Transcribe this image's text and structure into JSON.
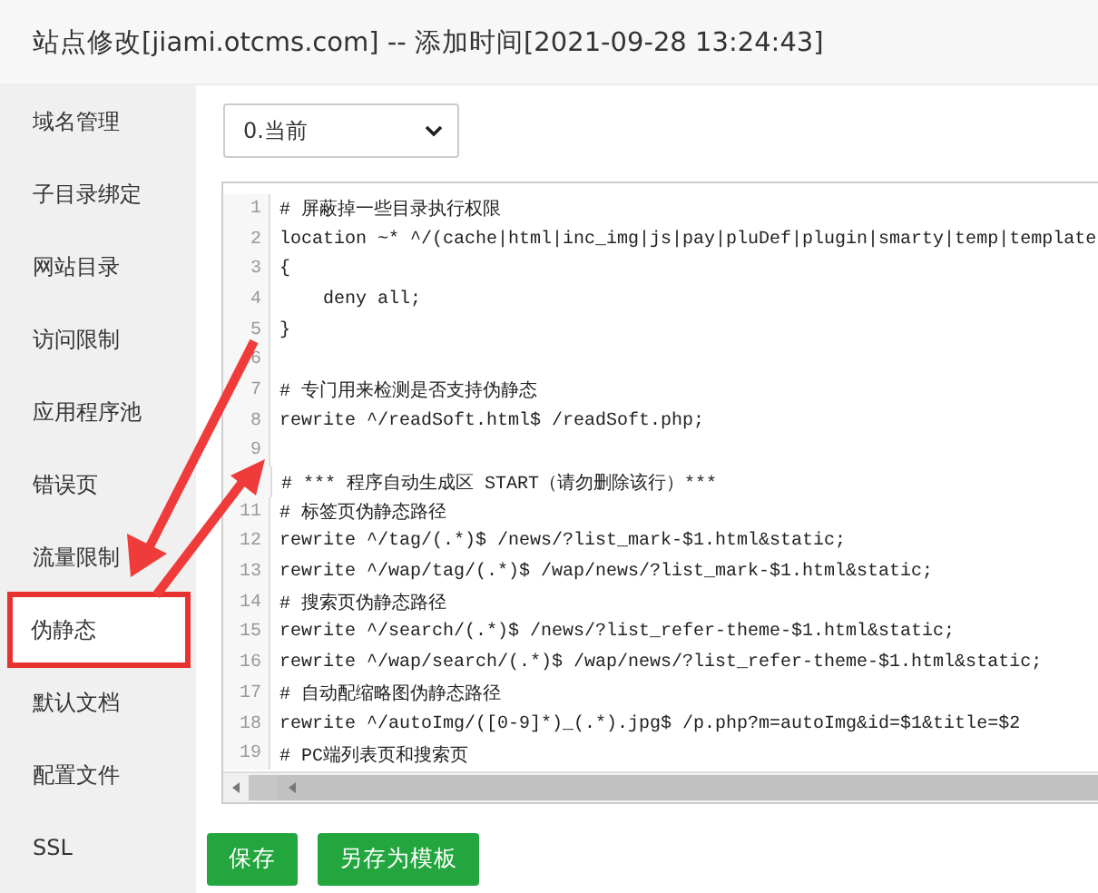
{
  "window": {
    "title": "站点修改[jiami.otcms.com] -- 添加时间[2021-09-28 13:24:43]"
  },
  "sidebar": {
    "items": [
      {
        "label": "域名管理",
        "selected": false,
        "highlighted": false
      },
      {
        "label": "子目录绑定",
        "selected": false,
        "highlighted": false
      },
      {
        "label": "网站目录",
        "selected": false,
        "highlighted": false
      },
      {
        "label": "访问限制",
        "selected": false,
        "highlighted": false
      },
      {
        "label": "应用程序池",
        "selected": false,
        "highlighted": false
      },
      {
        "label": "错误页",
        "selected": false,
        "highlighted": false
      },
      {
        "label": "流量限制",
        "selected": false,
        "highlighted": false
      },
      {
        "label": "伪静态",
        "selected": true,
        "highlighted": true
      },
      {
        "label": "默认文档",
        "selected": false,
        "highlighted": false
      },
      {
        "label": "配置文件",
        "selected": false,
        "highlighted": false
      },
      {
        "label": "SSL",
        "selected": false,
        "highlighted": false
      }
    ]
  },
  "version_select": {
    "value": "0.当前"
  },
  "editor": {
    "lines": [
      {
        "number": "1",
        "text": "# 屏蔽掉一些目录执行权限"
      },
      {
        "number": "2",
        "text": "location ~* ^/(cache|html|inc_img|js|pay|pluDef|plugin|smarty|temp|template"
      },
      {
        "number": "3",
        "text": "{"
      },
      {
        "number": "4",
        "text": "    deny all;"
      },
      {
        "number": "5",
        "text": "}"
      },
      {
        "number": "6"
      },
      {
        "number": "7",
        "text": "# 专门用来检测是否支持伪静态"
      },
      {
        "number": "8",
        "text": "rewrite ^/readSoft.html$ /readSoft.php;"
      },
      {
        "number": "9"
      },
      {
        "text": "# *** 程序自动生成区 START（请勿删除该行）***"
      },
      {
        "number": "11",
        "text": "# 标签页伪静态路径"
      },
      {
        "number": "12",
        "text": "rewrite ^/tag/(.*)$ /news/?list_mark-$1.html&static;"
      },
      {
        "number": "13",
        "text": "rewrite ^/wap/tag/(.*)$ /wap/news/?list_mark-$1.html&static;"
      },
      {
        "number": "14",
        "text": "# 搜索页伪静态路径"
      },
      {
        "number": "15",
        "text": "rewrite ^/search/(.*)$ /news/?list_refer-theme-$1.html&static;"
      },
      {
        "number": "16",
        "text": "rewrite ^/wap/search/(.*)$ /wap/news/?list_refer-theme-$1.html&static;"
      },
      {
        "number": "17",
        "text": "# 自动配缩略图伪静态路径"
      },
      {
        "number": "18",
        "text": "rewrite ^/autoImg/([0-9]*)_(.*).jpg$ /p.php?m=autoImg&id=$1&title=$2"
      },
      {
        "number": "19",
        "text": "# PC端列表页和搜索页"
      }
    ]
  },
  "buttons": [
    {
      "label": "保存"
    },
    {
      "label": "另存为模板"
    }
  ]
}
